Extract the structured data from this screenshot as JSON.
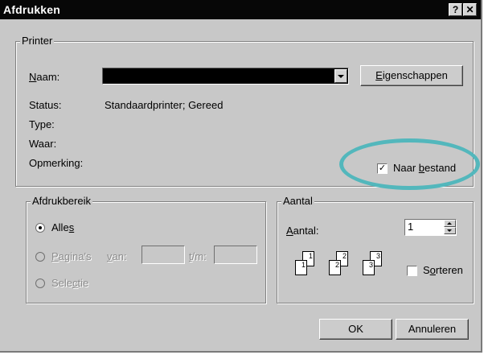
{
  "window": {
    "title": "Afdrukken",
    "help_btn": "?",
    "close_btn": "✕"
  },
  "printer": {
    "legend": "Printer",
    "name_label": "Naam:",
    "name_value": "",
    "properties_button": "Eigenschappen",
    "status_label": "Status:",
    "status_value": "Standaardprinter; Gereed",
    "type_label": "Type:",
    "where_label": "Waar:",
    "comment_label": "Opmerking:",
    "print_to_file_label": "Naar bestand",
    "print_to_file_checked": true
  },
  "range": {
    "legend": "Afdrukbereik",
    "all_label": "Alles",
    "pages_label": "Pagina's",
    "from_label": "van:",
    "to_label": "t/m:",
    "from_value": "",
    "to_value": "",
    "selection_label": "Selectie",
    "selected": "all"
  },
  "copies": {
    "legend": "Aantal",
    "count_label": "Aantal:",
    "count_value": "1",
    "collate_label": "Sorteren",
    "collate_checked": false,
    "icon_pages": [
      {
        "back": "1",
        "front": "1"
      },
      {
        "back": "2",
        "front": "2"
      },
      {
        "back": "3",
        "front": "3"
      }
    ]
  },
  "footer": {
    "ok_button": "OK",
    "cancel_button": "Annuleren"
  },
  "colors": {
    "dialog_bg": "#c8c8c8",
    "titlebar_bg": "#070707",
    "annotation_circle": "#53b7bc"
  }
}
